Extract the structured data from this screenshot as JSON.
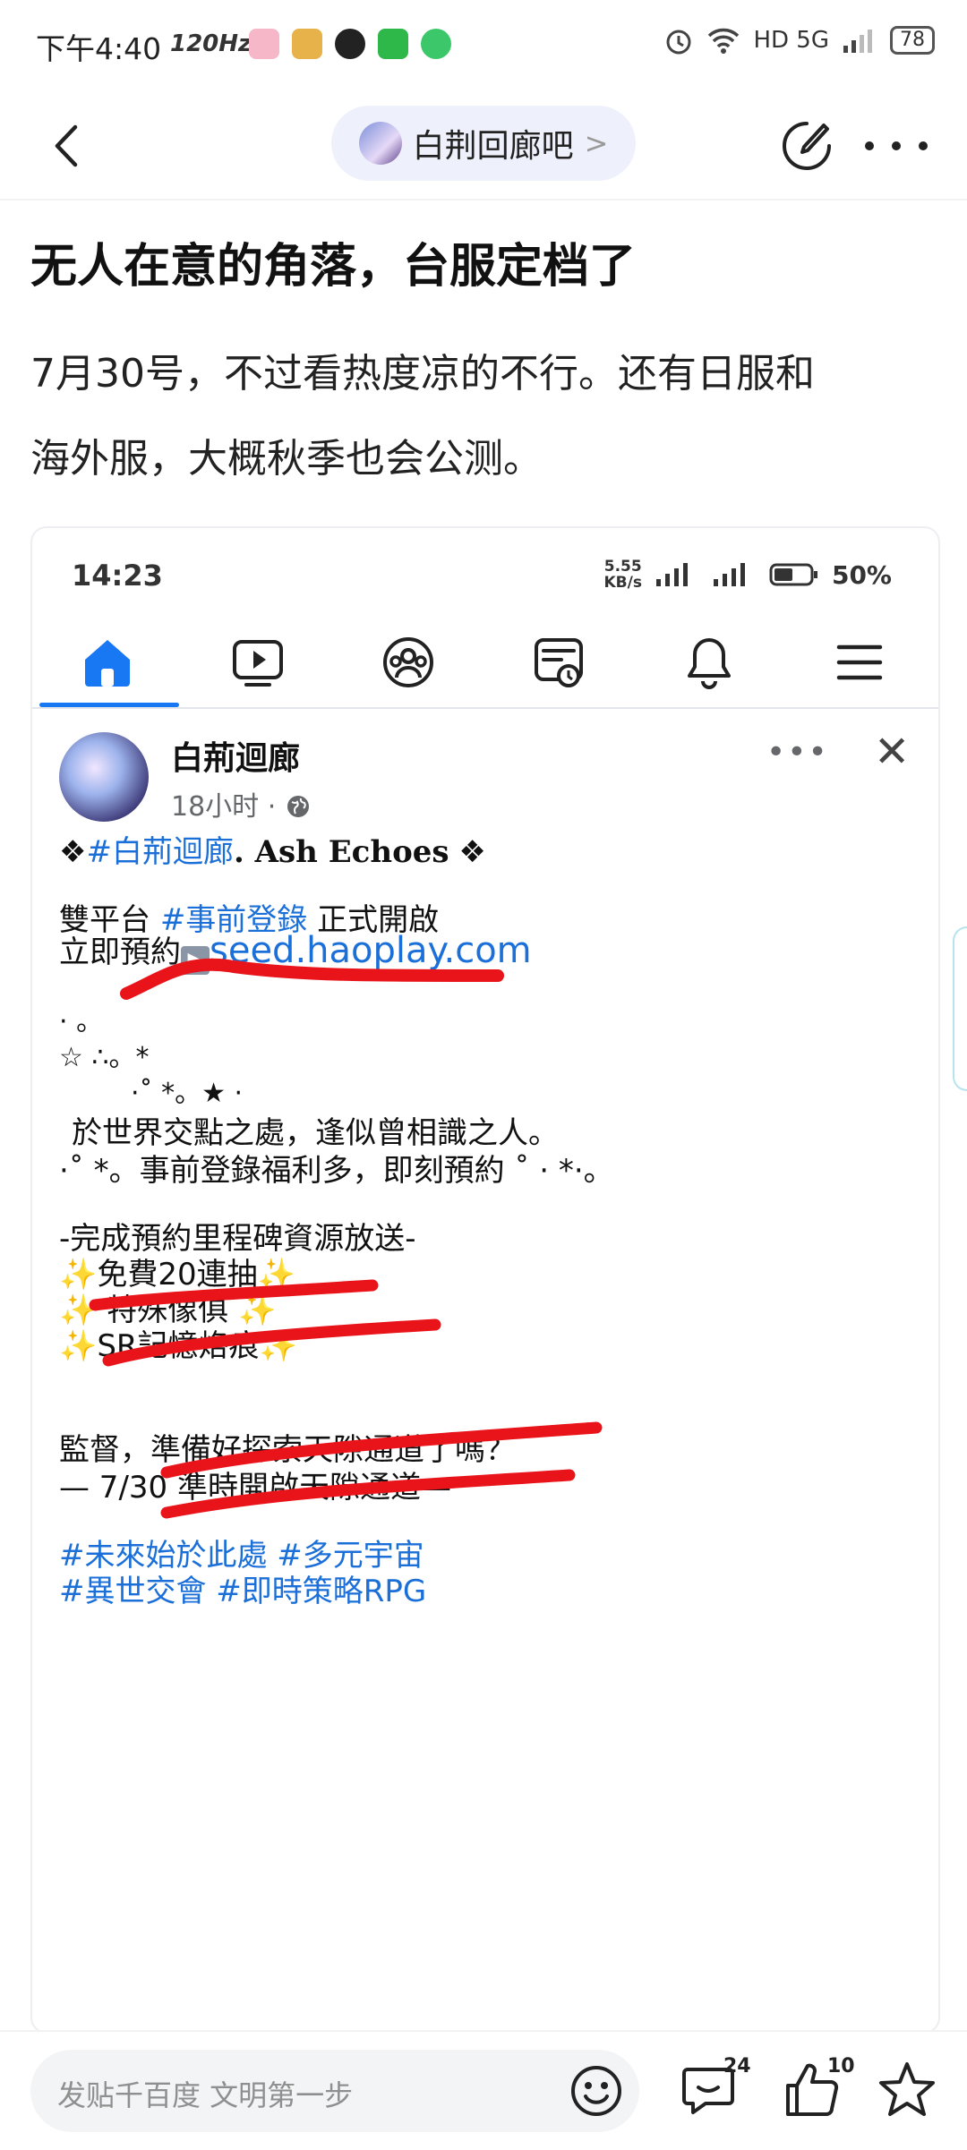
{
  "status_bar": {
    "time": "下午4:40",
    "refresh_rate": "120Hz",
    "network": "HD 5G",
    "battery": "78"
  },
  "nav": {
    "forum_name": "白荆回廊吧",
    "chevron": ">"
  },
  "post": {
    "title": "无人在意的角落，台服定档了",
    "body_line1": "7月30号，不过看热度凉的不行。还有日服和",
    "body_line2": "海外服，大概秋季也会公测。"
  },
  "screenshot": {
    "status_time": "14:23",
    "status_speed_top": "5.55",
    "status_speed_bottom": "KB/s",
    "status_battery": "50%",
    "page_name": "白荊迴廊",
    "post_time": "18小时",
    "line_title_tag": "#白荊迴廊",
    "line_title_rest": ". Ash Echoes",
    "line_platform_prefix": "雙平台 ",
    "line_platform_tag": "#事前登錄",
    "line_platform_suffix": " 正式開啟",
    "line_reserve_prefix": "立即預約",
    "line_reserve_link": "seed.haoplay.com",
    "deco1": "· 。",
    "deco2": "☆ ∴。*",
    "deco3": "·˚ *。★ ·",
    "line_poem": "於世界交點之處，逢似曾相識之人。",
    "line_reg": "·˚ *。事前登錄福利多，即刻預約 ˚ · *·。",
    "milestone": "-完成預約里程碑資源放送-",
    "reward1": "免費20連抽",
    "reward2": " 特殊像俱 ",
    "reward3": "SR記憶烙痕",
    "line_supervisor": "監督，準備好探索天隙通道了嗎？",
    "line_date": "— 7/30 準時開啟天隙通道—",
    "hashtags1": "#未來始於此處 #多元宇宙",
    "hashtags2": "#異世交會 #即時策略RPG"
  },
  "bottom": {
    "input_placeholder": "发贴千百度 文明第一步",
    "comment_count": "24",
    "like_count": "10"
  },
  "colors": {
    "fb_blue": "#1877f2",
    "link_blue": "#1b6fd8",
    "annotation_red": "#e8141a"
  }
}
